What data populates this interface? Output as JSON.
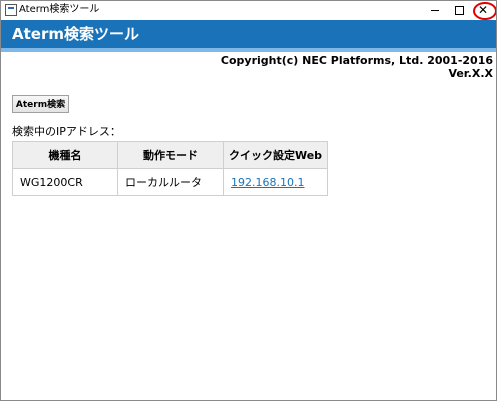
{
  "window": {
    "title": "Aterm検索ツール",
    "buttons": {
      "minimize": "",
      "maximize": "",
      "close": "✕"
    }
  },
  "header": {
    "title": "Aterm検索ツール"
  },
  "info": {
    "copyright": "Copyright(c) NEC Platforms, Ltd. 2001-2016",
    "version": "Ver.X.X"
  },
  "search_button": {
    "label": "Aterm検索"
  },
  "results": {
    "label": "検索中のIPアドレス：",
    "columns": [
      "機種名",
      "動作モード",
      "クイック設定Web"
    ],
    "rows": [
      {
        "model": "WG1200CR",
        "mode": "ローカルルータ",
        "ip": "192.168.10.1"
      }
    ]
  },
  "colors": {
    "header_bg": "#1a73b8",
    "header_stripe": "#7fb8e6",
    "link": "#1a73b8",
    "close_highlight": "#e00000"
  }
}
